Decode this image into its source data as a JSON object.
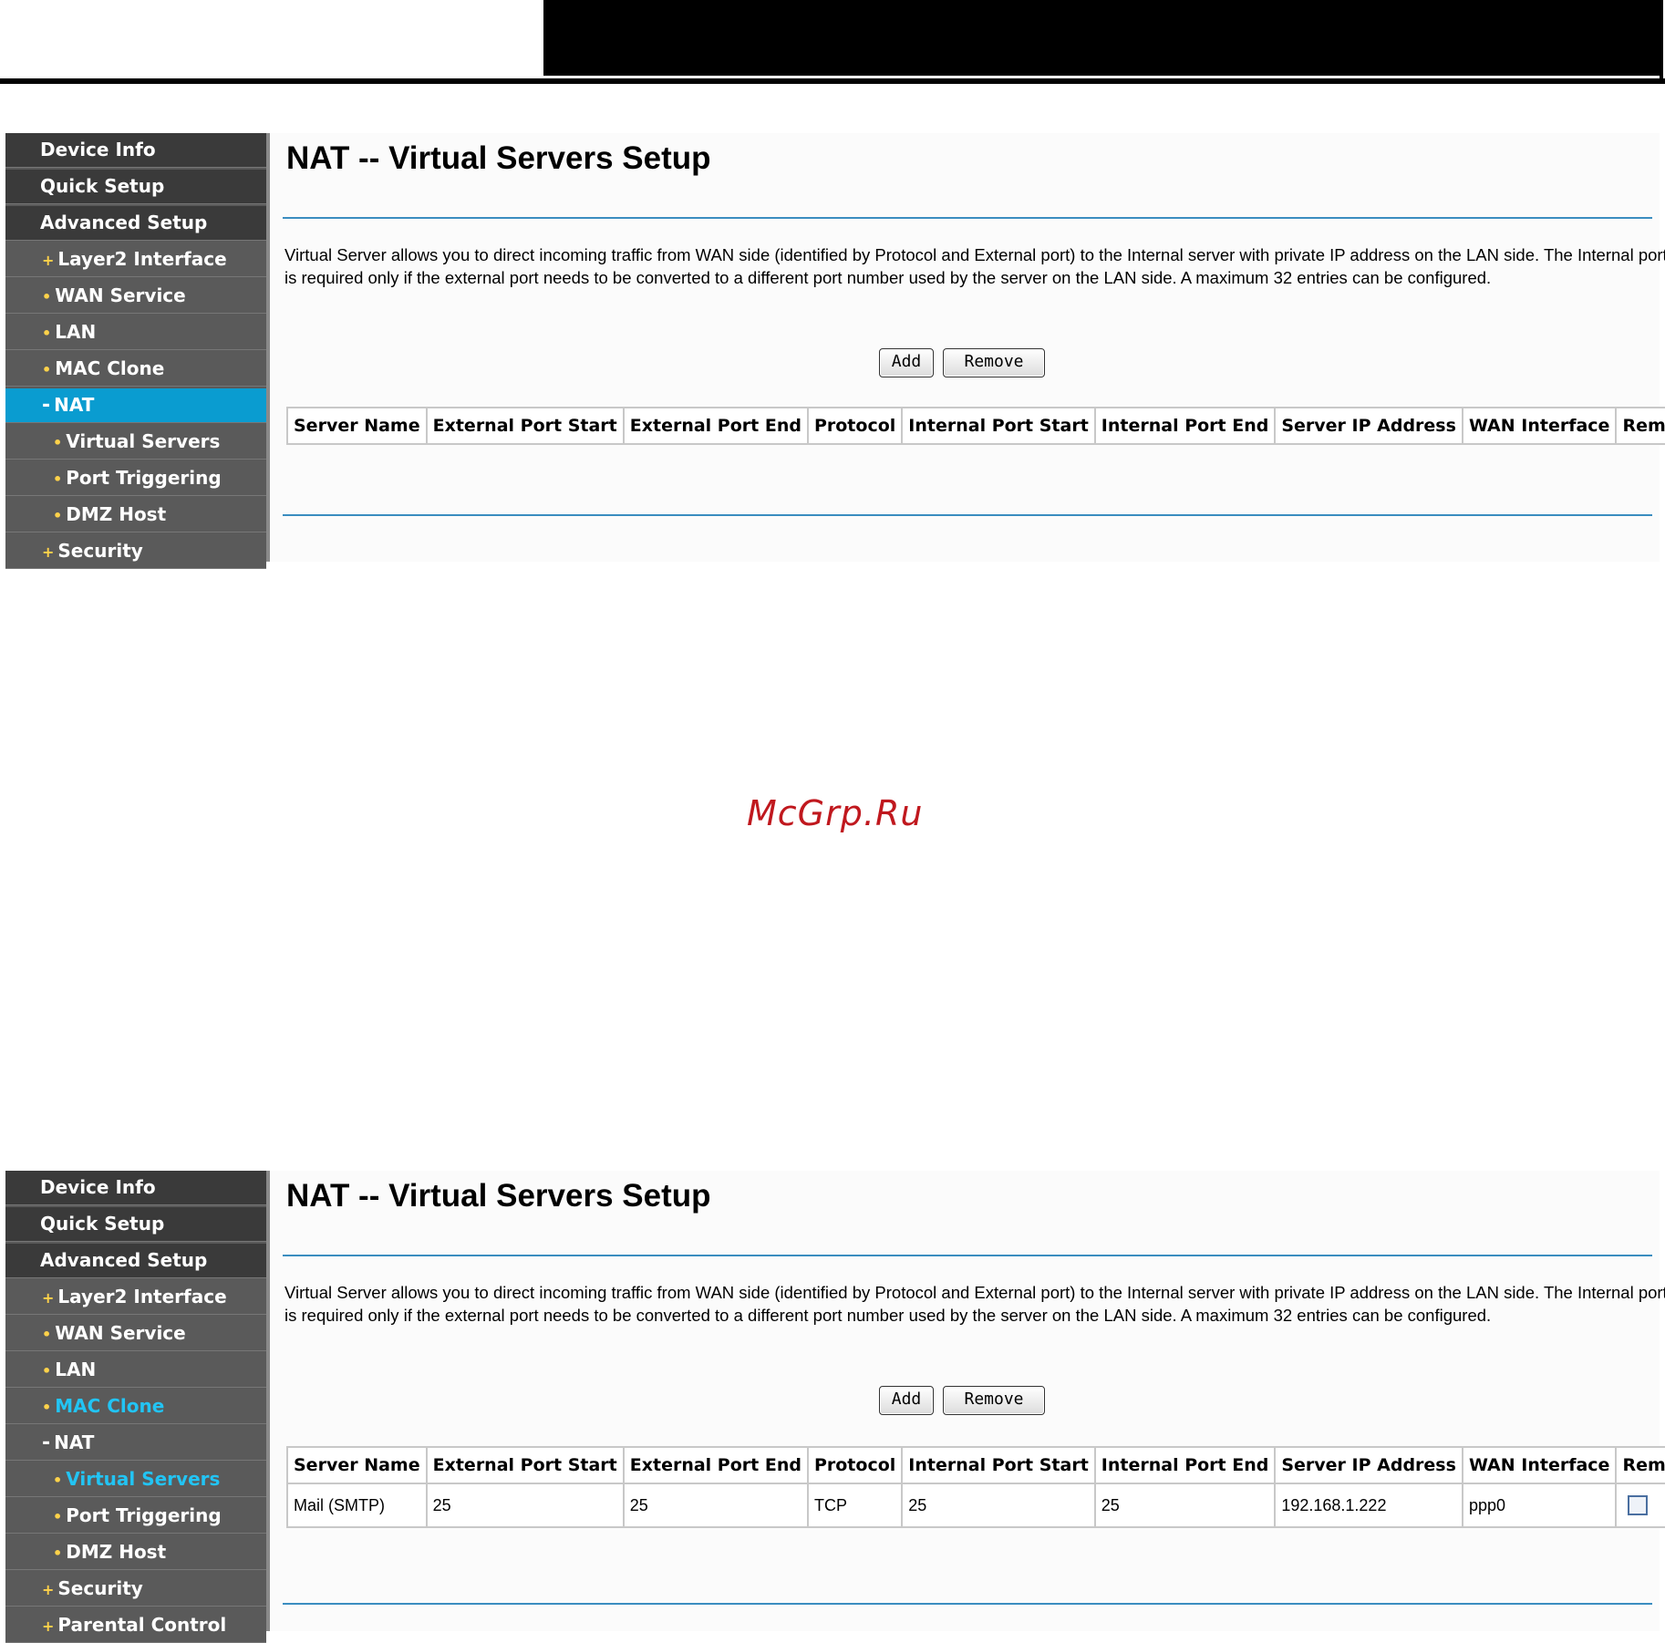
{
  "watermark": "McGrp.Ru",
  "screens": [
    {
      "title": "NAT -- Virtual Servers Setup",
      "description": "Virtual Server allows you to direct incoming traffic from WAN side (identified by Protocol and External port) to the Internal server with private IP address on the LAN side. The Internal port is required only if the external port needs to be converted to a different port number used by the server on the LAN side. A maximum 32 entries can be configured.",
      "buttons": {
        "add": "Add",
        "remove": "Remove"
      },
      "columns": [
        "Server Name",
        "External Port Start",
        "External Port End",
        "Protocol",
        "Internal Port Start",
        "Internal Port End",
        "Server IP Address",
        "WAN Interface",
        "Remove"
      ],
      "rows": [],
      "nav": [
        {
          "label": "Device Info",
          "marker": ""
        },
        {
          "label": "Quick Setup",
          "marker": ""
        },
        {
          "label": "Advanced Setup",
          "marker": ""
        },
        {
          "label": "Layer2 Interface",
          "marker": "+"
        },
        {
          "label": "WAN Service",
          "marker": "•"
        },
        {
          "label": "LAN",
          "marker": "•"
        },
        {
          "label": "MAC Clone",
          "marker": "•"
        },
        {
          "label": "NAT",
          "marker": "-"
        },
        {
          "label": "Virtual Servers",
          "marker": "•"
        },
        {
          "label": "Port Triggering",
          "marker": "•"
        },
        {
          "label": "DMZ Host",
          "marker": "•"
        },
        {
          "label": "Security",
          "marker": "+"
        }
      ]
    },
    {
      "title": "NAT -- Virtual Servers Setup",
      "description": "Virtual Server allows you to direct incoming traffic from WAN side (identified by Protocol and External port) to the Internal server with private IP address on the LAN side. The Internal port is required only if the external port needs to be converted to a different port number used by the server on the LAN side. A maximum 32 entries can be configured.",
      "buttons": {
        "add": "Add",
        "remove": "Remove"
      },
      "columns": [
        "Server Name",
        "External Port Start",
        "External Port End",
        "Protocol",
        "Internal Port Start",
        "Internal Port End",
        "Server IP Address",
        "WAN Interface",
        "Remove"
      ],
      "rows": [
        {
          "server_name": "Mail (SMTP)",
          "ext_start": "25",
          "ext_end": "25",
          "protocol": "TCP",
          "int_start": "25",
          "int_end": "25",
          "server_ip": "192.168.1.222",
          "wan_interface": "ppp0",
          "remove_checked": false
        }
      ],
      "nav": [
        {
          "label": "Device Info",
          "marker": ""
        },
        {
          "label": "Quick Setup",
          "marker": ""
        },
        {
          "label": "Advanced Setup",
          "marker": ""
        },
        {
          "label": "Layer2 Interface",
          "marker": "+"
        },
        {
          "label": "WAN Service",
          "marker": "•"
        },
        {
          "label": "LAN",
          "marker": "•"
        },
        {
          "label": "MAC Clone",
          "marker": "•"
        },
        {
          "label": "NAT",
          "marker": "-"
        },
        {
          "label": "Virtual Servers",
          "marker": "•"
        },
        {
          "label": "Port Triggering",
          "marker": "•"
        },
        {
          "label": "DMZ Host",
          "marker": "•"
        },
        {
          "label": "Security",
          "marker": "+"
        },
        {
          "label": "Parental Control",
          "marker": "+"
        }
      ]
    }
  ]
}
